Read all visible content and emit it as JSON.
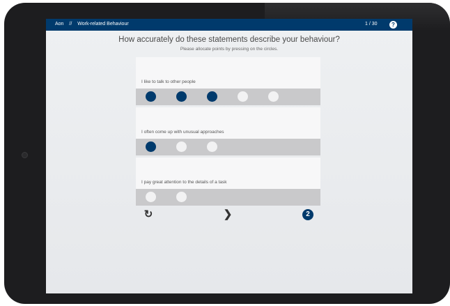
{
  "header": {
    "brand": "Aon",
    "separator": "//",
    "section": "Work-related Behaviour",
    "progress": "1 / 30",
    "help_icon": "?"
  },
  "question": {
    "title": "How accurately do these statements describe your behaviour?",
    "instruction": "Please allocate points by pressing on the circles."
  },
  "statements": [
    {
      "text": "I like to talk to other people",
      "dots": [
        true,
        true,
        true,
        false,
        false
      ]
    },
    {
      "text": "I often come up with unusual approaches",
      "dots": [
        true,
        false,
        false
      ]
    },
    {
      "text": "I pay great attention to the details of a task",
      "dots": [
        false,
        false
      ]
    }
  ],
  "controls": {
    "reset_icon": "↻",
    "next_icon": "❯",
    "help_label": "2"
  },
  "colors": {
    "accent": "#003a6c",
    "screen_bg": "#eceef0",
    "dot_empty": "#f2f2f3",
    "card_track": "#c9c9cb"
  }
}
